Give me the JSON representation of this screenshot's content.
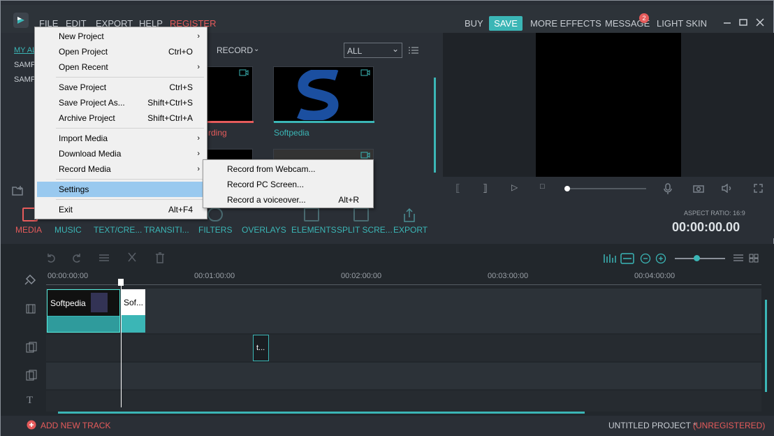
{
  "menubar": {
    "file": "FILE",
    "edit": "EDIT",
    "export": "EXPORT",
    "help": "HELP",
    "register": "REGISTER"
  },
  "topright": {
    "buy": "BUY",
    "save": "SAVE",
    "more_effects": "MORE EFFECTS",
    "message": "MESSAGE",
    "message_count": "2",
    "light_skin": "LIGHT SKIN"
  },
  "library": {
    "left_items": [
      "MY AL",
      "SAMP",
      "SAMP"
    ],
    "record_label": "RECORD",
    "filter_value": "ALL",
    "thumbs": [
      {
        "label": "rding"
      },
      {
        "label": "Softpedia"
      }
    ]
  },
  "toolbar": {
    "tabs": [
      "MEDIA",
      "MUSIC",
      "TEXT/CRE...",
      "TRANSITI...",
      "FILTERS",
      "OVERLAYS",
      "ELEMENTS",
      "SPLIT SCRE...",
      "EXPORT"
    ],
    "aspect_ratio": "ASPECT RATIO: 16:9",
    "timecode": "00:00:00.00"
  },
  "timeline": {
    "ruler": [
      "00:00:00:00",
      "00:01:00:00",
      "00:02:00:00",
      "00:03:00:00",
      "00:04:00:00"
    ],
    "clip1": "Softpedia",
    "clip2": "Sof...",
    "clip3": "t..."
  },
  "bottom": {
    "add_track": "ADD NEW TRACK",
    "project": "UNTITLED PROJECT *",
    "unregistered": "(UNREGISTERED)"
  },
  "filemenu": {
    "items": [
      {
        "label": "New Project",
        "shortcut": "",
        "arrow": "›"
      },
      {
        "label": "Open Project",
        "shortcut": "Ctrl+O",
        "arrow": ""
      },
      {
        "label": "Open Recent",
        "shortcut": "",
        "arrow": "›"
      },
      {
        "label": "Save Project",
        "shortcut": "Ctrl+S",
        "arrow": ""
      },
      {
        "label": "Save Project As...",
        "shortcut": "Shift+Ctrl+S",
        "arrow": ""
      },
      {
        "label": "Archive Project",
        "shortcut": "Shift+Ctrl+A",
        "arrow": ""
      },
      {
        "label": "Import Media",
        "shortcut": "",
        "arrow": "›"
      },
      {
        "label": "Download Media",
        "shortcut": "",
        "arrow": "›"
      },
      {
        "label": "Record Media",
        "shortcut": "",
        "arrow": "›"
      },
      {
        "label": "Settings",
        "shortcut": "",
        "arrow": ""
      },
      {
        "label": "Exit",
        "shortcut": "Alt+F4",
        "arrow": ""
      }
    ]
  },
  "submenu": {
    "items": [
      {
        "label": "Record from Webcam...",
        "shortcut": ""
      },
      {
        "label": "Record PC Screen...",
        "shortcut": ""
      },
      {
        "label": "Record a voiceover...",
        "shortcut": "Alt+R"
      }
    ]
  },
  "colors": {
    "accent": "#3bb6b6",
    "register": "#e55b5b",
    "bg": "#2a2f36"
  }
}
